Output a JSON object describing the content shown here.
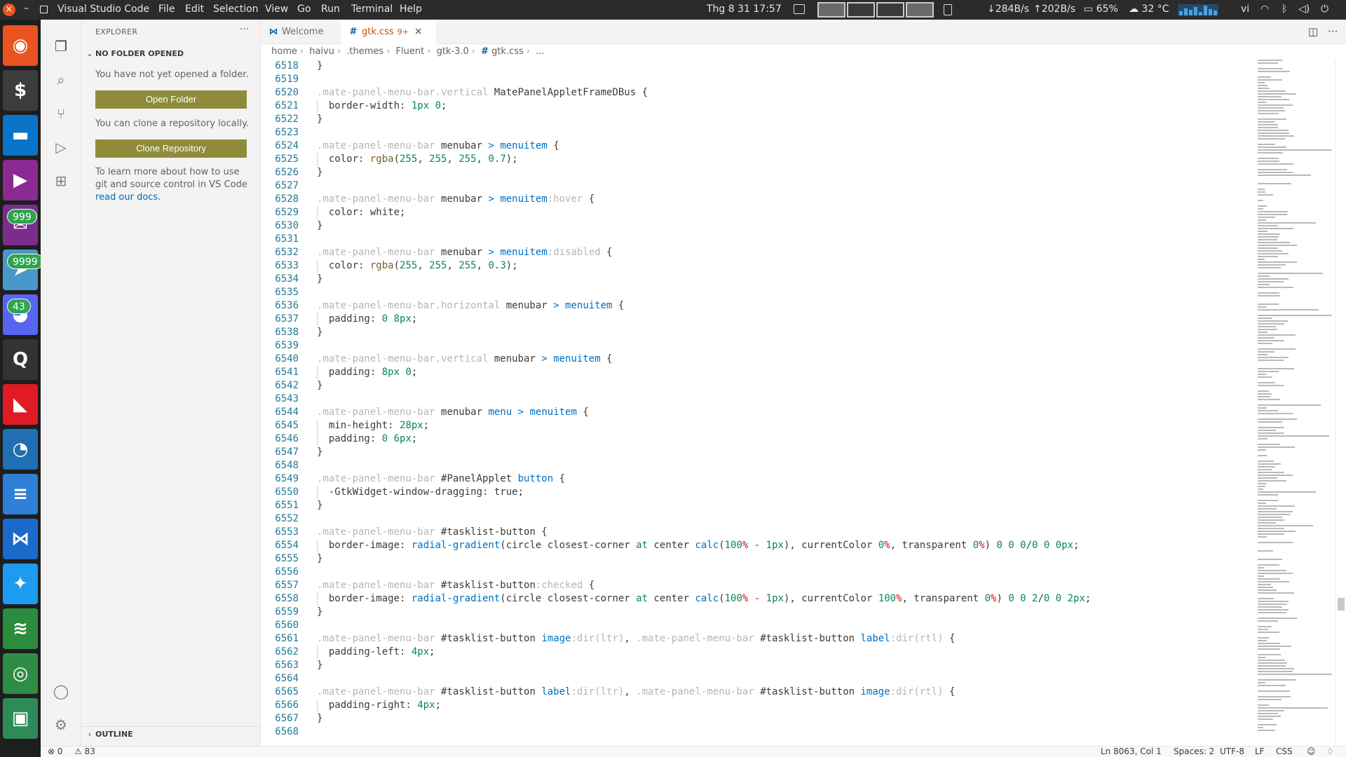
{
  "topbar": {
    "close_glyph": "×",
    "minimize_glyph": "–",
    "app_name": "Visual Studio Code",
    "menu": [
      "File",
      "Edit",
      "Selection",
      "View",
      "Go",
      "Run",
      "Terminal",
      "Help"
    ],
    "clock": "Thg 8 31  17:57",
    "net_down": "↓284B/s",
    "net_up": "↑202B/s",
    "battery": "65%",
    "temperature": "32 °C",
    "language": "vi",
    "icons": [
      "wifi-icon",
      "bluetooth-icon",
      "volume-icon",
      "power-icon"
    ]
  },
  "dock": {
    "items": [
      {
        "name": "ubuntu",
        "color": "#e95420",
        "glyph": "◉"
      },
      {
        "name": "terminal",
        "color": "#3c3c3c",
        "glyph": "$"
      },
      {
        "name": "files",
        "color": "#0a74c9",
        "glyph": "▬"
      },
      {
        "name": "video-player",
        "color": "#8c2a93",
        "glyph": "▶"
      },
      {
        "name": "messenger",
        "color": "#7b2d8e",
        "glyph": "✉",
        "badge": "999"
      },
      {
        "name": "telegram",
        "color": "#4a97c9",
        "glyph": "➤",
        "badge": "9999"
      },
      {
        "name": "discord",
        "color": "#5865f2",
        "glyph": "◕",
        "badge": "43"
      },
      {
        "name": "search-tool",
        "color": "#333333",
        "glyph": "Q"
      },
      {
        "name": "amd",
        "color": "#e01b24",
        "glyph": "◣"
      },
      {
        "name": "system-monitor",
        "color": "#1f6fb2",
        "glyph": "◔"
      },
      {
        "name": "text-editor",
        "color": "#2f7fd6",
        "glyph": "≡"
      },
      {
        "name": "vscode",
        "color": "#1b6ac9",
        "glyph": "⋈"
      },
      {
        "name": "twitter",
        "color": "#1d9bf0",
        "glyph": "✦"
      },
      {
        "name": "spotify",
        "color": "#2a8c3c",
        "glyph": "≋"
      },
      {
        "name": "audio",
        "color": "#2f8c44",
        "glyph": "◎"
      },
      {
        "name": "remote-desktop",
        "color": "#2e8b57",
        "glyph": "▣"
      }
    ]
  },
  "activity": {
    "items": [
      "explorer-icon",
      "search-icon",
      "source-control-icon",
      "run-debug-icon",
      "extensions-icon"
    ],
    "bottom": [
      "account-icon",
      "settings-icon"
    ]
  },
  "sidebar": {
    "title": "EXPLORER",
    "more": "···",
    "section": "NO FOLDER OPENED",
    "no_folder_text": "You have not yet opened a folder.",
    "open_folder": "Open Folder",
    "clone_text": "You can clone a repository locally.",
    "clone_button": "Clone Repository",
    "learn_text": "To learn more about how to use git and source control in VS Code ",
    "learn_link": "read our docs",
    "learn_end": ".",
    "outline": "OUTLINE"
  },
  "tabs": [
    {
      "label": "Welcome",
      "active": false
    },
    {
      "label": "gtk.css",
      "modified": "9+",
      "active": true
    }
  ],
  "breadcrumb": [
    "home",
    "haivu",
    ".themes",
    "Fluent",
    "gtk-3.0",
    "gtk.css",
    "..."
  ],
  "editor": {
    "lines": [
      {
        "n": "6518",
        "code": [
          [
            "p",
            "}"
          ]
        ],
        "guide": false
      },
      {
        "n": "6519",
        "code": []
      },
      {
        "n": "6520",
        "code": [
          [
            "c",
            ".mate-panel-menu-bar.vertical "
          ],
          [
            "p",
            "MatePanelAppletFrameDBus {"
          ]
        ]
      },
      {
        "n": "6521",
        "code": [
          [
            "p",
            "  border-width: "
          ],
          [
            "num",
            "1px"
          ],
          [
            "p",
            " "
          ],
          [
            "num",
            "0"
          ],
          [
            "p",
            ";"
          ]
        ],
        "guide": true
      },
      {
        "n": "6522",
        "code": [
          [
            "p",
            "}"
          ]
        ]
      },
      {
        "n": "6523",
        "code": []
      },
      {
        "n": "6524",
        "code": [
          [
            "c",
            ".mate-panel-menu-bar "
          ],
          [
            "p",
            "menubar "
          ],
          [
            "op",
            ">"
          ],
          [
            "p",
            " "
          ],
          [
            "op",
            "menuitem"
          ],
          [
            "p",
            " {"
          ]
        ]
      },
      {
        "n": "6525",
        "code": [
          [
            "p",
            "  color: "
          ],
          [
            "fn",
            "rgba"
          ],
          [
            "p",
            "("
          ],
          [
            "num",
            "255"
          ],
          [
            "p",
            ", "
          ],
          [
            "num",
            "255"
          ],
          [
            "p",
            ", "
          ],
          [
            "num",
            "255"
          ],
          [
            "p",
            ", "
          ],
          [
            "num",
            "0.7"
          ],
          [
            "p",
            ");"
          ]
        ],
        "guide": true
      },
      {
        "n": "6526",
        "code": [
          [
            "p",
            "}"
          ]
        ]
      },
      {
        "n": "6527",
        "code": []
      },
      {
        "n": "6528",
        "code": [
          [
            "c",
            ".mate-panel-menu-bar "
          ],
          [
            "p",
            "menubar "
          ],
          [
            "op",
            ">"
          ],
          [
            "p",
            " "
          ],
          [
            "op",
            "menuitem"
          ],
          [
            "c",
            ":hover"
          ],
          [
            "p",
            " {"
          ]
        ]
      },
      {
        "n": "6529",
        "code": [
          [
            "p",
            "  color: white;"
          ]
        ],
        "guide": true
      },
      {
        "n": "6530",
        "code": [
          [
            "p",
            "}"
          ]
        ]
      },
      {
        "n": "6531",
        "code": []
      },
      {
        "n": "6532",
        "code": [
          [
            "c",
            ".mate-panel-menu-bar "
          ],
          [
            "p",
            "menubar "
          ],
          [
            "op",
            ">"
          ],
          [
            "p",
            " "
          ],
          [
            "op",
            "menuitem"
          ],
          [
            "c",
            ":disabled"
          ],
          [
            "p",
            " {"
          ]
        ]
      },
      {
        "n": "6533",
        "code": [
          [
            "p",
            "  color: "
          ],
          [
            "fn",
            "rgba"
          ],
          [
            "p",
            "("
          ],
          [
            "num",
            "255"
          ],
          [
            "p",
            ", "
          ],
          [
            "num",
            "255"
          ],
          [
            "p",
            ", "
          ],
          [
            "num",
            "255"
          ],
          [
            "p",
            ", "
          ],
          [
            "num",
            "0.3"
          ],
          [
            "p",
            ");"
          ]
        ],
        "guide": true
      },
      {
        "n": "6534",
        "code": [
          [
            "p",
            "}"
          ]
        ]
      },
      {
        "n": "6535",
        "code": []
      },
      {
        "n": "6536",
        "code": [
          [
            "c",
            ".mate-panel-menu-bar.horizontal "
          ],
          [
            "p",
            "menubar "
          ],
          [
            "op",
            ">"
          ],
          [
            "p",
            " "
          ],
          [
            "op",
            "menuitem"
          ],
          [
            "p",
            " {"
          ]
        ]
      },
      {
        "n": "6537",
        "code": [
          [
            "p",
            "  padding: "
          ],
          [
            "num",
            "0"
          ],
          [
            "p",
            " "
          ],
          [
            "num",
            "8px"
          ],
          [
            "p",
            ";"
          ]
        ],
        "guide": true
      },
      {
        "n": "6538",
        "code": [
          [
            "p",
            "}"
          ]
        ]
      },
      {
        "n": "6539",
        "code": []
      },
      {
        "n": "6540",
        "code": [
          [
            "c",
            ".mate-panel-menu-bar.vertical "
          ],
          [
            "p",
            "menubar "
          ],
          [
            "op",
            ">"
          ],
          [
            "p",
            " "
          ],
          [
            "op",
            "menuitem"
          ],
          [
            "p",
            " {"
          ]
        ]
      },
      {
        "n": "6541",
        "code": [
          [
            "p",
            "  padding: "
          ],
          [
            "num",
            "8px"
          ],
          [
            "p",
            " "
          ],
          [
            "num",
            "0"
          ],
          [
            "p",
            ";"
          ]
        ],
        "guide": true
      },
      {
        "n": "6542",
        "code": [
          [
            "p",
            "}"
          ]
        ]
      },
      {
        "n": "6543",
        "code": []
      },
      {
        "n": "6544",
        "code": [
          [
            "c",
            ".mate-panel-menu-bar "
          ],
          [
            "p",
            "menubar "
          ],
          [
            "op",
            "menu"
          ],
          [
            "p",
            " "
          ],
          [
            "op",
            ">"
          ],
          [
            "p",
            " "
          ],
          [
            "op",
            "menuitem"
          ],
          [
            "p",
            " {"
          ]
        ]
      },
      {
        "n": "6545",
        "code": [
          [
            "p",
            "  min-height: "
          ],
          [
            "num",
            "28px"
          ],
          [
            "p",
            ";"
          ]
        ],
        "guide": true
      },
      {
        "n": "6546",
        "code": [
          [
            "p",
            "  padding: "
          ],
          [
            "num",
            "0"
          ],
          [
            "p",
            " "
          ],
          [
            "num",
            "6px"
          ],
          [
            "p",
            ";"
          ]
        ],
        "guide": true
      },
      {
        "n": "6547",
        "code": [
          [
            "p",
            "}"
          ]
        ]
      },
      {
        "n": "6548",
        "code": []
      },
      {
        "n": "6549",
        "code": [
          [
            "c",
            ".mate-panel-menu-bar "
          ],
          [
            "p",
            "#PanelApplet "
          ],
          [
            "op",
            "button"
          ],
          [
            "p",
            " {"
          ]
        ]
      },
      {
        "n": "6550",
        "code": [
          [
            "p",
            "  -GtkWidget-window-dragging: true;"
          ]
        ],
        "guide": true
      },
      {
        "n": "6551",
        "code": [
          [
            "p",
            "}"
          ]
        ]
      },
      {
        "n": "6552",
        "code": []
      },
      {
        "n": "6553",
        "code": [
          [
            "c",
            ".mate-panel-menu-bar "
          ],
          [
            "p",
            "#tasklist-button {"
          ]
        ]
      },
      {
        "n": "6554",
        "code": [
          [
            "p",
            "  border-image: "
          ],
          [
            "op",
            "radial-gradient"
          ],
          [
            "p",
            "(circle closest-corner "
          ],
          [
            "num",
            "at"
          ],
          [
            "p",
            " center "
          ],
          [
            "op",
            "calc"
          ],
          [
            "p",
            "("
          ],
          [
            "num",
            "100"
          ],
          [
            "prop",
            "%"
          ],
          [
            "p",
            " "
          ],
          [
            "prop",
            "-"
          ],
          [
            "p",
            " "
          ],
          [
            "num",
            "1px"
          ],
          [
            "p",
            "), currentColor "
          ],
          [
            "num",
            "0"
          ],
          [
            "prop",
            "%"
          ],
          [
            "p",
            ", transparent "
          ],
          [
            "num",
            "0"
          ],
          [
            "prop",
            "%"
          ],
          [
            "p",
            ") "
          ],
          [
            "num",
            "0 0 0"
          ],
          [
            "p",
            "/"
          ],
          [
            "num",
            "0 0 0px"
          ],
          [
            "p",
            ";"
          ]
        ],
        "guide": true
      },
      {
        "n": "6555",
        "code": [
          [
            "p",
            "}"
          ]
        ]
      },
      {
        "n": "6556",
        "code": []
      },
      {
        "n": "6557",
        "code": [
          [
            "c",
            ".mate-panel-menu-bar "
          ],
          [
            "p",
            "#tasklist-button"
          ],
          [
            "c",
            ":checked"
          ],
          [
            "p",
            " {"
          ]
        ]
      },
      {
        "n": "6558",
        "code": [
          [
            "p",
            "  border-image: "
          ],
          [
            "op",
            "radial-gradient"
          ],
          [
            "p",
            "(circle closest-corner "
          ],
          [
            "num",
            "at"
          ],
          [
            "p",
            " center "
          ],
          [
            "op",
            "calc"
          ],
          [
            "p",
            "("
          ],
          [
            "num",
            "100"
          ],
          [
            "prop",
            "%"
          ],
          [
            "p",
            " "
          ],
          [
            "prop",
            "-"
          ],
          [
            "p",
            " "
          ],
          [
            "num",
            "1px"
          ],
          [
            "p",
            "), currentColor "
          ],
          [
            "num",
            "100"
          ],
          [
            "prop",
            "%"
          ],
          [
            "p",
            ", transparent "
          ],
          [
            "num",
            "0"
          ],
          [
            "prop",
            "%"
          ],
          [
            "p",
            ") "
          ],
          [
            "num",
            "0 0 2"
          ],
          [
            "p",
            "/"
          ],
          [
            "num",
            "0 0 2px"
          ],
          [
            "p",
            ";"
          ]
        ],
        "guide": true
      },
      {
        "n": "6559",
        "code": [
          [
            "p",
            "}"
          ]
        ]
      },
      {
        "n": "6560",
        "code": []
      },
      {
        "n": "6561",
        "code": [
          [
            "c",
            ".mate-panel-menu-bar "
          ],
          [
            "p",
            "#tasklist-button "
          ],
          [
            "op",
            "image"
          ],
          [
            "c",
            ":dir(ltr)"
          ],
          [
            "p",
            ", "
          ],
          [
            "c",
            ".mate-panel-menu-bar "
          ],
          [
            "p",
            "#tasklist-button "
          ],
          [
            "op",
            "label"
          ],
          [
            "c",
            ":dir(rtl)"
          ],
          [
            "p",
            " {"
          ]
        ]
      },
      {
        "n": "6562",
        "code": [
          [
            "p",
            "  padding-left: "
          ],
          [
            "num",
            "4px"
          ],
          [
            "p",
            ";"
          ]
        ],
        "guide": true
      },
      {
        "n": "6563",
        "code": [
          [
            "p",
            "}"
          ]
        ]
      },
      {
        "n": "6564",
        "code": []
      },
      {
        "n": "6565",
        "code": [
          [
            "c",
            ".mate-panel-menu-bar "
          ],
          [
            "p",
            "#tasklist-button "
          ],
          [
            "op",
            "label"
          ],
          [
            "c",
            ":dir(ltr)"
          ],
          [
            "p",
            ", "
          ],
          [
            "c",
            ".mate-panel-menu-bar "
          ],
          [
            "p",
            "#tasklist-button "
          ],
          [
            "op",
            "image"
          ],
          [
            "c",
            ":dir(rtl)"
          ],
          [
            "p",
            " {"
          ]
        ]
      },
      {
        "n": "6566",
        "code": [
          [
            "p",
            "  padding-right: "
          ],
          [
            "num",
            "4px"
          ],
          [
            "p",
            ";"
          ]
        ],
        "guide": true
      },
      {
        "n": "6567",
        "code": [
          [
            "p",
            "}"
          ]
        ]
      },
      {
        "n": "6568",
        "code": []
      }
    ]
  },
  "status": {
    "errors": "⊗ 0",
    "warnings": "⚠ 83",
    "position": "Ln 8063, Col 1",
    "spaces": "Spaces: 2",
    "encoding": "UTF-8",
    "eol": "LF",
    "language": "CSS"
  },
  "colors": {
    "accent": "#c4500a",
    "button": "#8f8b3a",
    "link": "#006ab1",
    "line_number": "#237893"
  }
}
